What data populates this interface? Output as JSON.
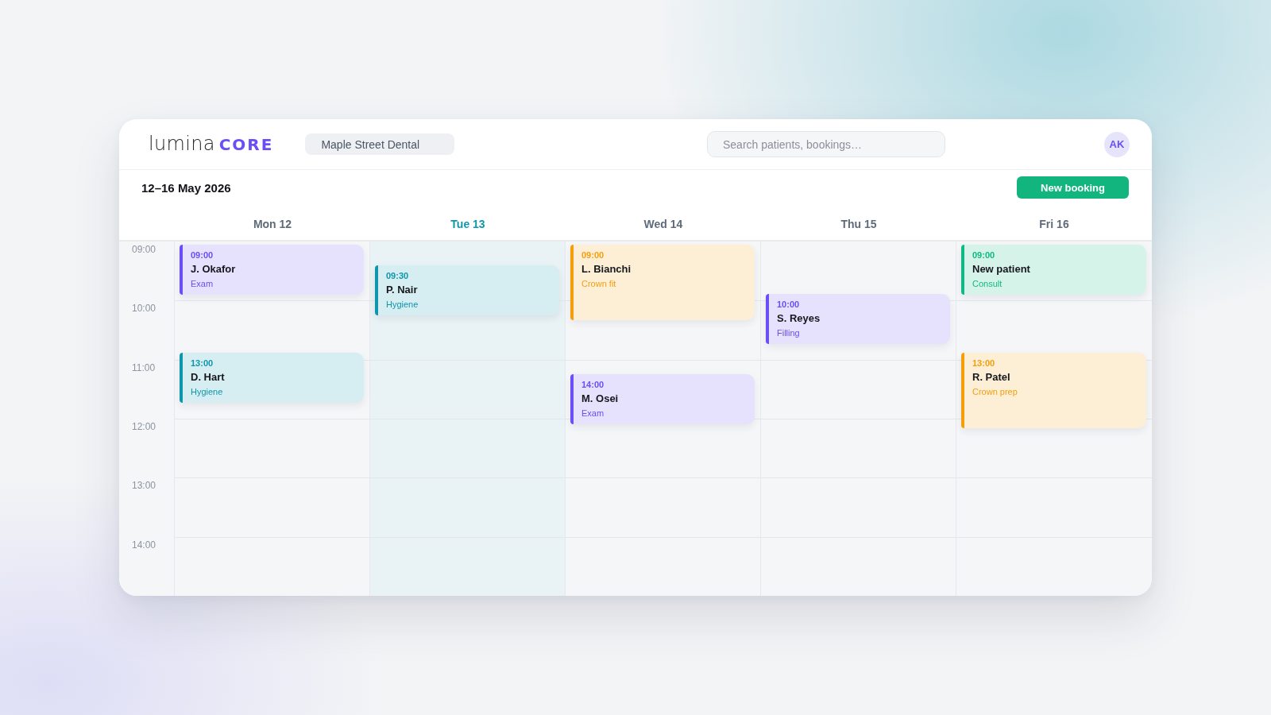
{
  "brand": {
    "name": "lumina",
    "product": "CORE"
  },
  "practice": "Maple Street Dental",
  "search": {
    "placeholder": "Search patients, bookings…"
  },
  "user": {
    "initials": "AK"
  },
  "toolbar": {
    "title": "12–16 May 2026",
    "primary_action": "New booking"
  },
  "time_slots": [
    "09:00",
    "10:00",
    "11:00",
    "12:00",
    "13:00",
    "14:00"
  ],
  "days": [
    {
      "label": "Mon 12",
      "today": false,
      "appointments": [
        {
          "time": "09:00",
          "patient": "J. Okafor",
          "treatment": "Exam",
          "color": "#6b4ef6"
        },
        {
          "time": "13:00",
          "patient": "D. Hart",
          "treatment": "Hygiene",
          "color": "#0e97ab"
        }
      ]
    },
    {
      "label": "Tue 13",
      "today": true,
      "appointments": [
        {
          "time": "09:30",
          "patient": "P. Nair",
          "treatment": "Hygiene",
          "color": "#0e97ab"
        }
      ]
    },
    {
      "label": "Wed 14",
      "today": false,
      "appointments": [
        {
          "time": "09:00",
          "patient": "L. Bianchi",
          "treatment": "Crown fit",
          "color": "#f59e0b"
        },
        {
          "time": "14:00",
          "patient": "M. Osei",
          "treatment": "Exam",
          "color": "#6b4ef6"
        }
      ]
    },
    {
      "label": "Thu 15",
      "today": false,
      "appointments": [
        {
          "time": "10:00",
          "patient": "S. Reyes",
          "treatment": "Filling",
          "color": "#6b4ef6"
        }
      ]
    },
    {
      "label": "Fri 16",
      "today": false,
      "appointments": [
        {
          "time": "09:00",
          "patient": "New patient",
          "treatment": "Consult",
          "color": "#10b981"
        },
        {
          "time": "13:00",
          "patient": "R. Patel",
          "treatment": "Crown prep",
          "color": "#f59e0b"
        }
      ]
    }
  ]
}
